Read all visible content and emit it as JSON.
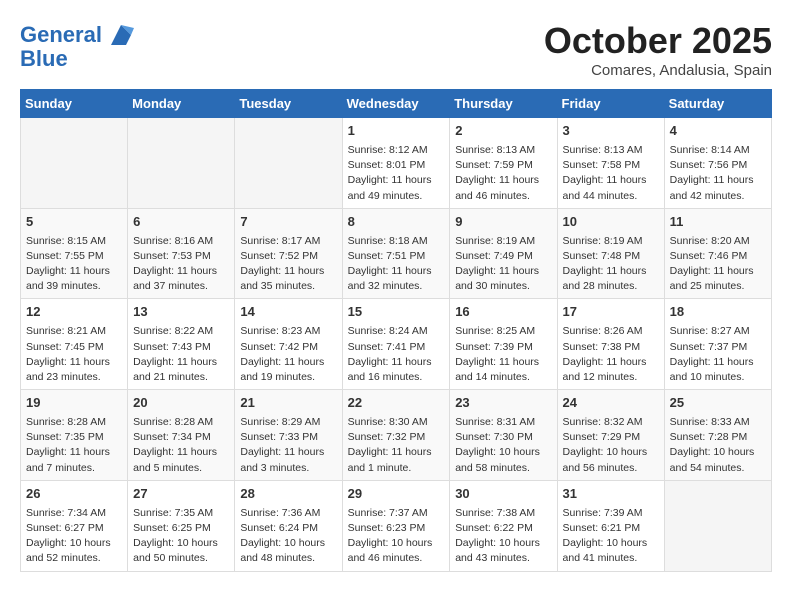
{
  "header": {
    "logo_line1": "General",
    "logo_line2": "Blue",
    "month": "October 2025",
    "location": "Comares, Andalusia, Spain"
  },
  "days_of_week": [
    "Sunday",
    "Monday",
    "Tuesday",
    "Wednesday",
    "Thursday",
    "Friday",
    "Saturday"
  ],
  "weeks": [
    [
      {
        "day": "",
        "info": ""
      },
      {
        "day": "",
        "info": ""
      },
      {
        "day": "",
        "info": ""
      },
      {
        "day": "1",
        "info": "Sunrise: 8:12 AM\nSunset: 8:01 PM\nDaylight: 11 hours and 49 minutes."
      },
      {
        "day": "2",
        "info": "Sunrise: 8:13 AM\nSunset: 7:59 PM\nDaylight: 11 hours and 46 minutes."
      },
      {
        "day": "3",
        "info": "Sunrise: 8:13 AM\nSunset: 7:58 PM\nDaylight: 11 hours and 44 minutes."
      },
      {
        "day": "4",
        "info": "Sunrise: 8:14 AM\nSunset: 7:56 PM\nDaylight: 11 hours and 42 minutes."
      }
    ],
    [
      {
        "day": "5",
        "info": "Sunrise: 8:15 AM\nSunset: 7:55 PM\nDaylight: 11 hours and 39 minutes."
      },
      {
        "day": "6",
        "info": "Sunrise: 8:16 AM\nSunset: 7:53 PM\nDaylight: 11 hours and 37 minutes."
      },
      {
        "day": "7",
        "info": "Sunrise: 8:17 AM\nSunset: 7:52 PM\nDaylight: 11 hours and 35 minutes."
      },
      {
        "day": "8",
        "info": "Sunrise: 8:18 AM\nSunset: 7:51 PM\nDaylight: 11 hours and 32 minutes."
      },
      {
        "day": "9",
        "info": "Sunrise: 8:19 AM\nSunset: 7:49 PM\nDaylight: 11 hours and 30 minutes."
      },
      {
        "day": "10",
        "info": "Sunrise: 8:19 AM\nSunset: 7:48 PM\nDaylight: 11 hours and 28 minutes."
      },
      {
        "day": "11",
        "info": "Sunrise: 8:20 AM\nSunset: 7:46 PM\nDaylight: 11 hours and 25 minutes."
      }
    ],
    [
      {
        "day": "12",
        "info": "Sunrise: 8:21 AM\nSunset: 7:45 PM\nDaylight: 11 hours and 23 minutes."
      },
      {
        "day": "13",
        "info": "Sunrise: 8:22 AM\nSunset: 7:43 PM\nDaylight: 11 hours and 21 minutes."
      },
      {
        "day": "14",
        "info": "Sunrise: 8:23 AM\nSunset: 7:42 PM\nDaylight: 11 hours and 19 minutes."
      },
      {
        "day": "15",
        "info": "Sunrise: 8:24 AM\nSunset: 7:41 PM\nDaylight: 11 hours and 16 minutes."
      },
      {
        "day": "16",
        "info": "Sunrise: 8:25 AM\nSunset: 7:39 PM\nDaylight: 11 hours and 14 minutes."
      },
      {
        "day": "17",
        "info": "Sunrise: 8:26 AM\nSunset: 7:38 PM\nDaylight: 11 hours and 12 minutes."
      },
      {
        "day": "18",
        "info": "Sunrise: 8:27 AM\nSunset: 7:37 PM\nDaylight: 11 hours and 10 minutes."
      }
    ],
    [
      {
        "day": "19",
        "info": "Sunrise: 8:28 AM\nSunset: 7:35 PM\nDaylight: 11 hours and 7 minutes."
      },
      {
        "day": "20",
        "info": "Sunrise: 8:28 AM\nSunset: 7:34 PM\nDaylight: 11 hours and 5 minutes."
      },
      {
        "day": "21",
        "info": "Sunrise: 8:29 AM\nSunset: 7:33 PM\nDaylight: 11 hours and 3 minutes."
      },
      {
        "day": "22",
        "info": "Sunrise: 8:30 AM\nSunset: 7:32 PM\nDaylight: 11 hours and 1 minute."
      },
      {
        "day": "23",
        "info": "Sunrise: 8:31 AM\nSunset: 7:30 PM\nDaylight: 10 hours and 58 minutes."
      },
      {
        "day": "24",
        "info": "Sunrise: 8:32 AM\nSunset: 7:29 PM\nDaylight: 10 hours and 56 minutes."
      },
      {
        "day": "25",
        "info": "Sunrise: 8:33 AM\nSunset: 7:28 PM\nDaylight: 10 hours and 54 minutes."
      }
    ],
    [
      {
        "day": "26",
        "info": "Sunrise: 7:34 AM\nSunset: 6:27 PM\nDaylight: 10 hours and 52 minutes."
      },
      {
        "day": "27",
        "info": "Sunrise: 7:35 AM\nSunset: 6:25 PM\nDaylight: 10 hours and 50 minutes."
      },
      {
        "day": "28",
        "info": "Sunrise: 7:36 AM\nSunset: 6:24 PM\nDaylight: 10 hours and 48 minutes."
      },
      {
        "day": "29",
        "info": "Sunrise: 7:37 AM\nSunset: 6:23 PM\nDaylight: 10 hours and 46 minutes."
      },
      {
        "day": "30",
        "info": "Sunrise: 7:38 AM\nSunset: 6:22 PM\nDaylight: 10 hours and 43 minutes."
      },
      {
        "day": "31",
        "info": "Sunrise: 7:39 AM\nSunset: 6:21 PM\nDaylight: 10 hours and 41 minutes."
      },
      {
        "day": "",
        "info": ""
      }
    ]
  ]
}
